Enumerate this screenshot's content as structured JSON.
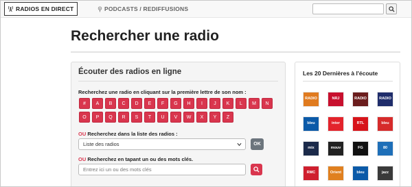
{
  "nav": {
    "live_label": "RADIOS EN DIRECT",
    "podcasts_label": "PODCASTS / REDIFFUSIONS",
    "search_placeholder": ""
  },
  "page": {
    "title": "Rechercher une radio"
  },
  "left_panel": {
    "heading": "Écouter des radios en ligne",
    "instruction": "Recherchez une radio en cliquant sur la première lettre de son nom :",
    "letters": [
      "#",
      "A",
      "B",
      "C",
      "D",
      "E",
      "F",
      "G",
      "H",
      "I",
      "J",
      "K",
      "L",
      "M",
      "N",
      "O",
      "P",
      "Q",
      "R",
      "S",
      "T",
      "U",
      "V",
      "W",
      "X",
      "Y",
      "Z"
    ],
    "or_label": "OU",
    "list_prompt": "Recherchez dans la liste des radios :",
    "select_value": "Liste des radios",
    "ok_label": "OK",
    "keyword_prompt": "Recherchez en tapant un ou des mots clés.",
    "keyword_placeholder": "Entrez ici un ou des mots clés"
  },
  "right_panel": {
    "heading": "Les 20 Dernières à l'écoute",
    "logos": [
      {
        "name": "Radio Classique",
        "text": "RADIO",
        "color": "#e07b1f"
      },
      {
        "name": "NRJ",
        "text": "NRJ",
        "color": "#c8102e"
      },
      {
        "name": "Radio Nova",
        "text": "RADIO",
        "color": "#6b1d1d"
      },
      {
        "name": "Radio France",
        "text": "RADIO",
        "color": "#1f2d6b"
      },
      {
        "name": "France Bleu",
        "text": "bleu",
        "color": "#0b5aa8"
      },
      {
        "name": "France Inter",
        "text": "inter",
        "color": "#e3232c"
      },
      {
        "name": "RTL",
        "text": "RTL",
        "color": "#d7141a"
      },
      {
        "name": "Radio Alpes",
        "text": "bleu",
        "color": "#d62b2b"
      },
      {
        "name": "Radio Mix",
        "text": "mix",
        "color": "#1b2a4a"
      },
      {
        "name": "Radio Mouv",
        "text": "mouv",
        "color": "#222222"
      },
      {
        "name": "Radio FG",
        "text": "FG",
        "color": "#111111"
      },
      {
        "name": "Radio 80",
        "text": "80",
        "color": "#1e6fb8"
      },
      {
        "name": "RMC",
        "text": "RMC",
        "color": "#cf1f2e"
      },
      {
        "name": "Radio Orient",
        "text": "Orient",
        "color": "#e0801f"
      },
      {
        "name": "France Bleu 2",
        "text": "bleu",
        "color": "#0b5aa8"
      },
      {
        "name": "Radio Jazz",
        "text": "jazz",
        "color": "#3a3a3a"
      }
    ]
  }
}
